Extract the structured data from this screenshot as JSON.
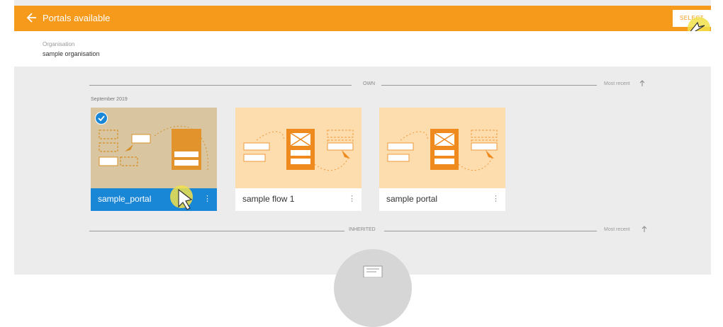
{
  "header": {
    "title": "Portals available",
    "select_label": "SELECT"
  },
  "org": {
    "label": "Organisation",
    "value": "sample organisation"
  },
  "sections": {
    "own": {
      "label": "OWN",
      "sort_label": "Most recent"
    },
    "inherited": {
      "label": "INHERITED",
      "sort_label": "Most recent"
    }
  },
  "group": {
    "month": "September 2019"
  },
  "cards": [
    {
      "name": "sample_portal",
      "selected": true
    },
    {
      "name": "sample flow 1",
      "selected": false
    },
    {
      "name": "sample portal",
      "selected": false
    }
  ],
  "colors": {
    "accent": "#f59a1b",
    "selected": "#1a86d6",
    "thumb_bg": "#fddcae",
    "thumb_selected_bg": "#d9c6a1"
  }
}
